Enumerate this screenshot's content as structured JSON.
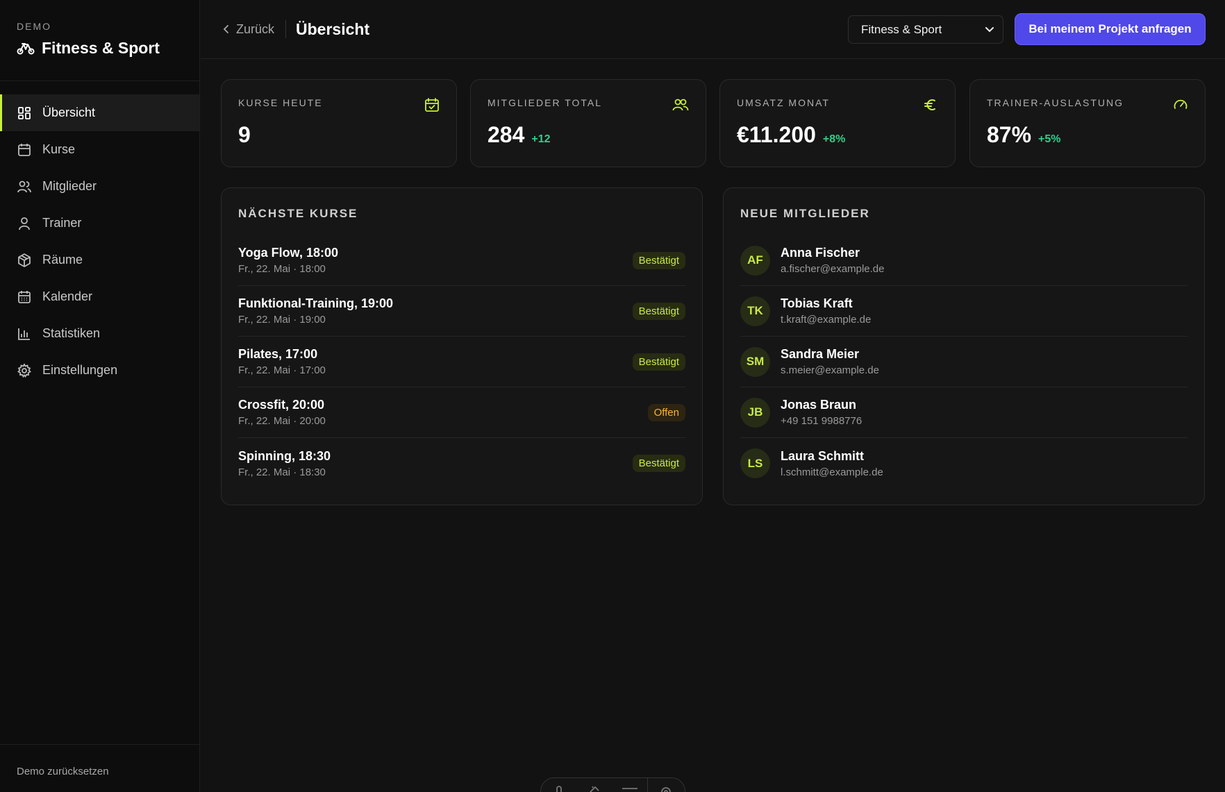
{
  "brand": {
    "demo": "DEMO",
    "title": "Fitness & Sport"
  },
  "nav": [
    {
      "label": "Übersicht",
      "icon": "grid-icon",
      "active": true
    },
    {
      "label": "Kurse",
      "icon": "calendar-icon"
    },
    {
      "label": "Mitglieder",
      "icon": "users-icon"
    },
    {
      "label": "Trainer",
      "icon": "user-icon"
    },
    {
      "label": "Räume",
      "icon": "box-icon"
    },
    {
      "label": "Kalender",
      "icon": "calendar-grid-icon"
    },
    {
      "label": "Statistiken",
      "icon": "bar-chart-icon"
    },
    {
      "label": "Einstellungen",
      "icon": "gear-icon"
    }
  ],
  "sidebar_footer": "Demo zurücksetzen",
  "header": {
    "back": "Zurück",
    "title": "Übersicht",
    "select_value": "Fitness & Sport",
    "cta": "Bei meinem Projekt anfragen"
  },
  "stats": [
    {
      "label": "KURSE HEUTE",
      "value": "9",
      "delta": "",
      "icon": "calendar-check-icon"
    },
    {
      "label": "MITGLIEDER TOTAL",
      "value": "284",
      "delta": "+12",
      "icon": "users-icon"
    },
    {
      "label": "UMSATZ MONAT",
      "value": "€11.200",
      "delta": "+8%",
      "icon": "euro-icon"
    },
    {
      "label": "TRAINER-AUSLASTUNG",
      "value": "87%",
      "delta": "+5%",
      "icon": "gauge-icon"
    }
  ],
  "courses": {
    "title": "NÄCHSTE KURSE",
    "items": [
      {
        "title": "Yoga Flow, 18:00",
        "sub": "Fr., 22. Mai · 18:00",
        "status": "Bestätigt"
      },
      {
        "title": "Funktional-Training, 19:00",
        "sub": "Fr., 22. Mai · 19:00",
        "status": "Bestätigt"
      },
      {
        "title": "Pilates, 17:00",
        "sub": "Fr., 22. Mai · 17:00",
        "status": "Bestätigt"
      },
      {
        "title": "Crossfit, 20:00",
        "sub": "Fr., 22. Mai · 20:00",
        "status": "Offen"
      },
      {
        "title": "Spinning, 18:30",
        "sub": "Fr., 22. Mai · 18:30",
        "status": "Bestätigt"
      }
    ]
  },
  "members": {
    "title": "NEUE MITGLIEDER",
    "items": [
      {
        "initials": "AF",
        "name": "Anna Fischer",
        "contact": "a.fischer@example.de"
      },
      {
        "initials": "TK",
        "name": "Tobias Kraft",
        "contact": "t.kraft@example.de"
      },
      {
        "initials": "SM",
        "name": "Sandra Meier",
        "contact": "s.meier@example.de"
      },
      {
        "initials": "JB",
        "name": "Jonas Braun",
        "contact": "+49 151 9988776"
      },
      {
        "initials": "LS",
        "name": "Laura Schmitt",
        "contact": "l.schmitt@example.de"
      }
    ]
  },
  "colors": {
    "accent": "#c8f03c",
    "cta": "#5048e8",
    "positive": "#2fd08a",
    "warning": "#f0b830"
  }
}
